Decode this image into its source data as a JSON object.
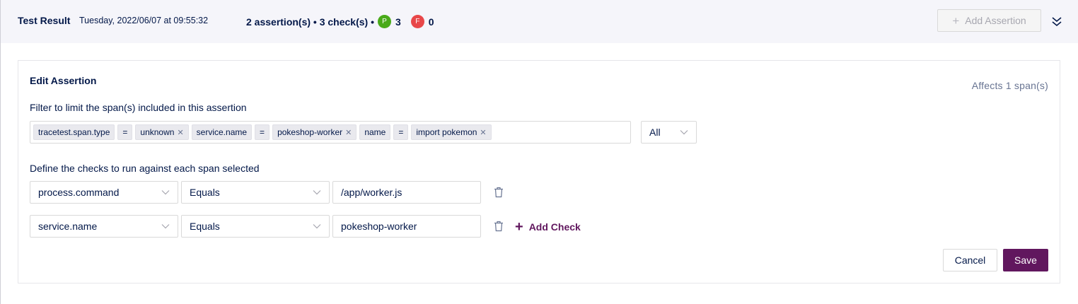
{
  "header": {
    "title": "Test Result",
    "date": "Tuesday, 2022/06/07 at 09:55:32",
    "summary": "2 assertion(s) • 3 check(s) •",
    "pass_badge": "P",
    "pass_count": "3",
    "fail_badge": "F",
    "fail_count": "0",
    "add_assertion_label": "Add Assertion",
    "colors": {
      "pass": "#49aa19",
      "fail": "#e84749"
    }
  },
  "edit": {
    "title": "Edit Assertion",
    "affects": "Affects 1 span(s)",
    "filter_label": "Filter to limit the span(s) included in this assertion",
    "filter_tags": [
      {
        "key": "tracetest.span.type",
        "op": "=",
        "value": "unknown"
      },
      {
        "key": "service.name",
        "op": "=",
        "value": "pokeshop-worker"
      },
      {
        "key": "name",
        "op": "=",
        "value": "import pokemon"
      }
    ],
    "match_select": "All",
    "checks_label": "Define the checks to run against each span selected",
    "checks": [
      {
        "attribute": "process.command",
        "comparator": "Equals",
        "value": "/app/worker.js"
      },
      {
        "attribute": "service.name",
        "comparator": "Equals",
        "value": "pokeshop-worker"
      }
    ],
    "add_check_label": "Add Check",
    "cancel_label": "Cancel",
    "save_label": "Save",
    "accent_color": "#61175e"
  }
}
